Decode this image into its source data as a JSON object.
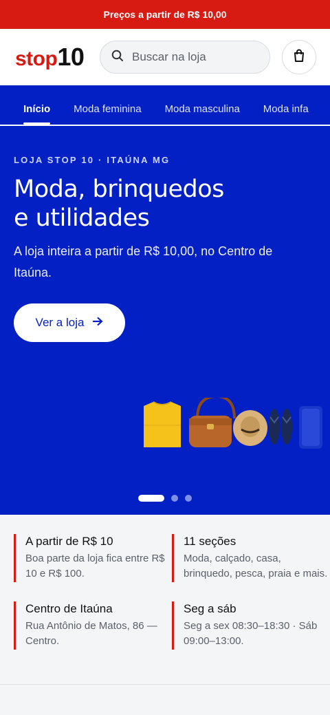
{
  "promo": {
    "text": "Preços a partir de R$ 10,00"
  },
  "header": {
    "logo_stop": "stop",
    "logo_ten": "10",
    "search_placeholder": "Buscar na loja"
  },
  "nav": {
    "items": [
      {
        "label": "Início",
        "active": true
      },
      {
        "label": "Moda feminina"
      },
      {
        "label": "Moda masculina"
      },
      {
        "label": "Moda infa"
      }
    ]
  },
  "hero": {
    "eyebrow": "LOJA STOP 10 · ITAÚNA MG",
    "title_line1": "Moda, brinquedos",
    "title_line2": "e utilidades",
    "subtitle": "A loja inteira a partir de R$ 10,00, no Centro de Itaúna.",
    "cta_label": "Ver a loja",
    "slides": 3,
    "active_slide": 1
  },
  "features": [
    {
      "title": "A partir de R$ 10",
      "text": "Boa parte da loja fica entre R$ 10 e R$ 100."
    },
    {
      "title": "11 seções",
      "text": "Moda, calçado, casa, brinquedo, pesca, praia e mais."
    },
    {
      "title": "Centro de Itaúna",
      "text": "Rua Antônio de Matos, 86 — Centro."
    },
    {
      "title": "Seg a sáb",
      "text": "Seg a sex 08:30–18:30 · Sáb 09:00–13:00."
    }
  ],
  "colors": {
    "brand_red": "#d71a12",
    "brand_blue": "#0320c4"
  },
  "icons": [
    "search-icon",
    "shopping-bag-icon",
    "arrow-right-icon"
  ]
}
